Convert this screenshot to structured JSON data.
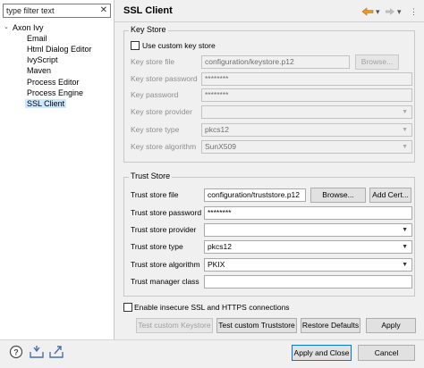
{
  "filter": {
    "placeholder": "type filter text"
  },
  "tree": {
    "root": "Axon Ivy",
    "items": [
      "Email",
      "Html Dialog Editor",
      "IvyScript",
      "Maven",
      "Process Editor",
      "Process Engine",
      "SSL Client"
    ],
    "selected": "SSL Client"
  },
  "header": {
    "title": "SSL Client"
  },
  "key_store": {
    "group_title": "Key Store",
    "use_custom_label": "Use custom key store",
    "file_label": "Key store file",
    "file_value": "configuration/keystore.p12",
    "browse_label": "Browse...",
    "password_label": "Key store password",
    "password_value": "********",
    "key_password_label": "Key password",
    "key_password_value": "********",
    "provider_label": "Key store provider",
    "provider_value": "",
    "type_label": "Key store type",
    "type_value": "pkcs12",
    "algorithm_label": "Key store algorithm",
    "algorithm_value": "SunX509"
  },
  "trust_store": {
    "group_title": "Trust Store",
    "file_label": "Trust store file",
    "file_value": "configuration/truststore.p12",
    "browse_label": "Browse...",
    "add_cert_label": "Add Cert...",
    "password_label": "Trust store password",
    "password_value": "********",
    "provider_label": "Trust store provider",
    "provider_value": "",
    "type_label": "Trust store type",
    "type_value": "pkcs12",
    "algorithm_label": "Trust store algorithm",
    "algorithm_value": "PKIX",
    "manager_label": "Trust manager class",
    "manager_value": ""
  },
  "insecure_label": "Enable insecure SSL and HTTPS connections",
  "actions": {
    "test_keystore": "Test custom Keystore",
    "test_truststore": "Test custom Truststore",
    "restore_defaults": "Restore Defaults",
    "apply": "Apply"
  },
  "dialog": {
    "apply_close": "Apply and Close",
    "cancel": "Cancel"
  },
  "icons": [
    "help-icon",
    "import-icon",
    "export-icon",
    "back-icon",
    "forward-icon",
    "view-menu-icon"
  ],
  "colors": {
    "selection": "#cce8ff",
    "accent": "#0078d7",
    "nav_arrow": "#e39a2b"
  }
}
